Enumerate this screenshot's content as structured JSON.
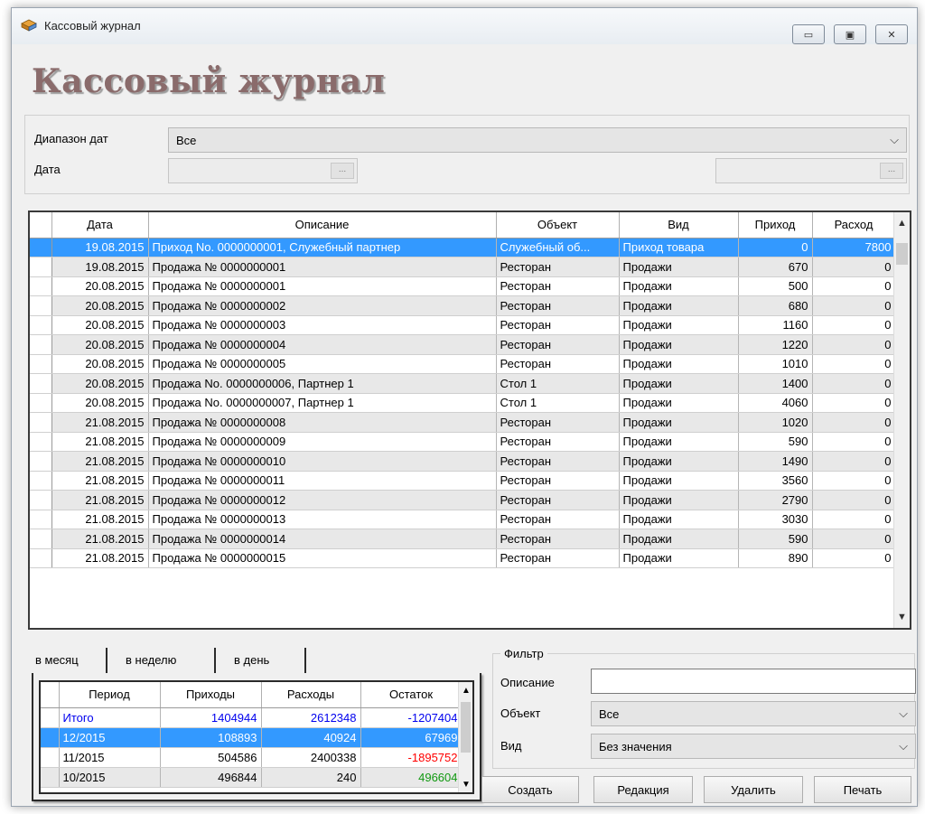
{
  "window": {
    "title": "Кассовый журнал",
    "heading": "Кассовый журнал",
    "controls": {
      "minimize": "▭",
      "maximize": "▣",
      "close": "✕"
    }
  },
  "params": {
    "date_range_label": "Диапазон дат",
    "date_range_value": "Все",
    "date_label": "Дата",
    "date_from": "",
    "date_to": "",
    "dots": "..."
  },
  "journal": {
    "columns": [
      "Дата",
      "Описание",
      "Объект",
      "Вид",
      "Приход",
      "Расход"
    ],
    "rows": [
      {
        "date": "19.08.2015",
        "description": "Приход No. 0000000001, Служебный партнер",
        "object": "Служебный об...",
        "type": "Приход товара",
        "income": "0",
        "expense": "7800"
      },
      {
        "date": "19.08.2015",
        "description": "Продажа № 0000000001",
        "object": "Ресторан",
        "type": "Продажи",
        "income": "670",
        "expense": "0"
      },
      {
        "date": "20.08.2015",
        "description": "Продажа № 0000000001",
        "object": "Ресторан",
        "type": "Продажи",
        "income": "500",
        "expense": "0"
      },
      {
        "date": "20.08.2015",
        "description": "Продажа № 0000000002",
        "object": "Ресторан",
        "type": "Продажи",
        "income": "680",
        "expense": "0"
      },
      {
        "date": "20.08.2015",
        "description": "Продажа № 0000000003",
        "object": "Ресторан",
        "type": "Продажи",
        "income": "1160",
        "expense": "0"
      },
      {
        "date": "20.08.2015",
        "description": "Продажа № 0000000004",
        "object": "Ресторан",
        "type": "Продажи",
        "income": "1220",
        "expense": "0"
      },
      {
        "date": "20.08.2015",
        "description": "Продажа № 0000000005",
        "object": "Ресторан",
        "type": "Продажи",
        "income": "1010",
        "expense": "0"
      },
      {
        "date": "20.08.2015",
        "description": "Продажа No. 0000000006, Партнер 1",
        "object": "Стол 1",
        "type": "Продажи",
        "income": "1400",
        "expense": "0"
      },
      {
        "date": "20.08.2015",
        "description": "Продажа No. 0000000007, Партнер 1",
        "object": "Стол 1",
        "type": "Продажи",
        "income": "4060",
        "expense": "0"
      },
      {
        "date": "21.08.2015",
        "description": "Продажа № 0000000008",
        "object": "Ресторан",
        "type": "Продажи",
        "income": "1020",
        "expense": "0"
      },
      {
        "date": "21.08.2015",
        "description": "Продажа № 0000000009",
        "object": "Ресторан",
        "type": "Продажи",
        "income": "590",
        "expense": "0"
      },
      {
        "date": "21.08.2015",
        "description": "Продажа № 0000000010",
        "object": "Ресторан",
        "type": "Продажи",
        "income": "1490",
        "expense": "0"
      },
      {
        "date": "21.08.2015",
        "description": "Продажа № 0000000011",
        "object": "Ресторан",
        "type": "Продажи",
        "income": "3560",
        "expense": "0"
      },
      {
        "date": "21.08.2015",
        "description": "Продажа № 0000000012",
        "object": "Ресторан",
        "type": "Продажи",
        "income": "2790",
        "expense": "0"
      },
      {
        "date": "21.08.2015",
        "description": "Продажа № 0000000013",
        "object": "Ресторан",
        "type": "Продажи",
        "income": "3030",
        "expense": "0"
      },
      {
        "date": "21.08.2015",
        "description": "Продажа № 0000000014",
        "object": "Ресторан",
        "type": "Продажи",
        "income": "590",
        "expense": "0"
      },
      {
        "date": "21.08.2015",
        "description": "Продажа № 0000000015",
        "object": "Ресторан",
        "type": "Продажи",
        "income": "890",
        "expense": "0"
      }
    ],
    "selected_row": 0
  },
  "summary": {
    "tabs": [
      "в месяц",
      "в неделю",
      "в день"
    ],
    "columns": [
      "Период",
      "Приходы",
      "Расходы",
      "Остаток"
    ],
    "rows": [
      {
        "period": "Итого",
        "income": "1404944",
        "expense": "2612348",
        "balance": "-1207404",
        "style": "total"
      },
      {
        "period": "12/2015",
        "income": "108893",
        "expense": "40924",
        "balance": "67969",
        "style": "selected"
      },
      {
        "period": "11/2015",
        "income": "504586",
        "expense": "2400338",
        "balance": "-1895752",
        "style": "negative"
      },
      {
        "period": "10/2015",
        "income": "496844",
        "expense": "240",
        "balance": "496604",
        "style": "positive"
      }
    ]
  },
  "filter": {
    "legend": "Фильтр",
    "description_label": "Описание",
    "description_value": "",
    "object_label": "Объект",
    "object_value": "Все",
    "type_label": "Вид",
    "type_value": "Без значения"
  },
  "buttons": {
    "create": "Создать",
    "edit": "Редакция",
    "delete": "Удалить",
    "print": "Печать"
  },
  "colors": {
    "selection": "#3399ff",
    "total_text": "#0000ee",
    "negative_text": "#ff0000",
    "positive_text": "#119911"
  }
}
